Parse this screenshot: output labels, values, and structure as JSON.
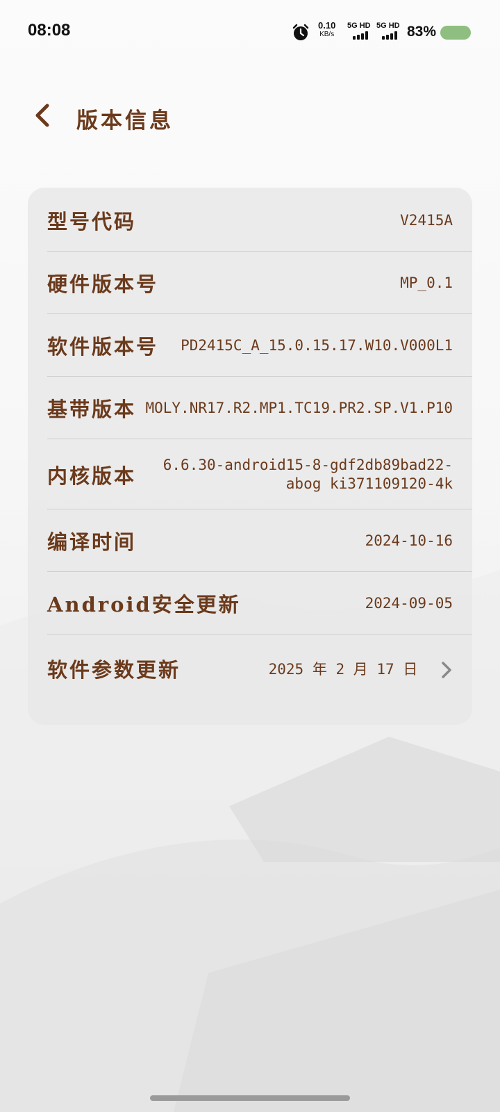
{
  "status_bar": {
    "time": "08:08",
    "net_speed_value": "0.10",
    "net_speed_unit": "KB/s",
    "sim1_label": "5G HD",
    "sim2_label": "5G HD",
    "battery_percent": "83%",
    "battery_level": 0.83,
    "battery_color": "#8fbf80"
  },
  "header": {
    "title": "版本信息",
    "back_icon": "chevron-left-icon"
  },
  "rows": [
    {
      "label": "型号代码",
      "value": "V2415A"
    },
    {
      "label": "硬件版本号",
      "value": "MP_0.1"
    },
    {
      "label": "软件版本号",
      "value": "PD2415C_A_15.0.15.17.W10.V000L1"
    },
    {
      "label": "基带版本",
      "value": "MOLY.NR17.R2.MP1.TC19.PR2.SP.V1.P10"
    },
    {
      "label": "内核版本",
      "value": "6.6.30-android15-8-gdf2db89bad22-abog ki371109120-4k"
    },
    {
      "label": "编译时间",
      "value": "2024-10-16"
    },
    {
      "label": "Android安全更新",
      "value": "2024-09-05"
    },
    {
      "label": "软件参数更新",
      "value": "2025 年 2 月 17 日",
      "icon": "chevron-right-icon"
    }
  ],
  "colors": {
    "accent_text": "#6b3a1c",
    "card_background": "#e8e8e8"
  }
}
